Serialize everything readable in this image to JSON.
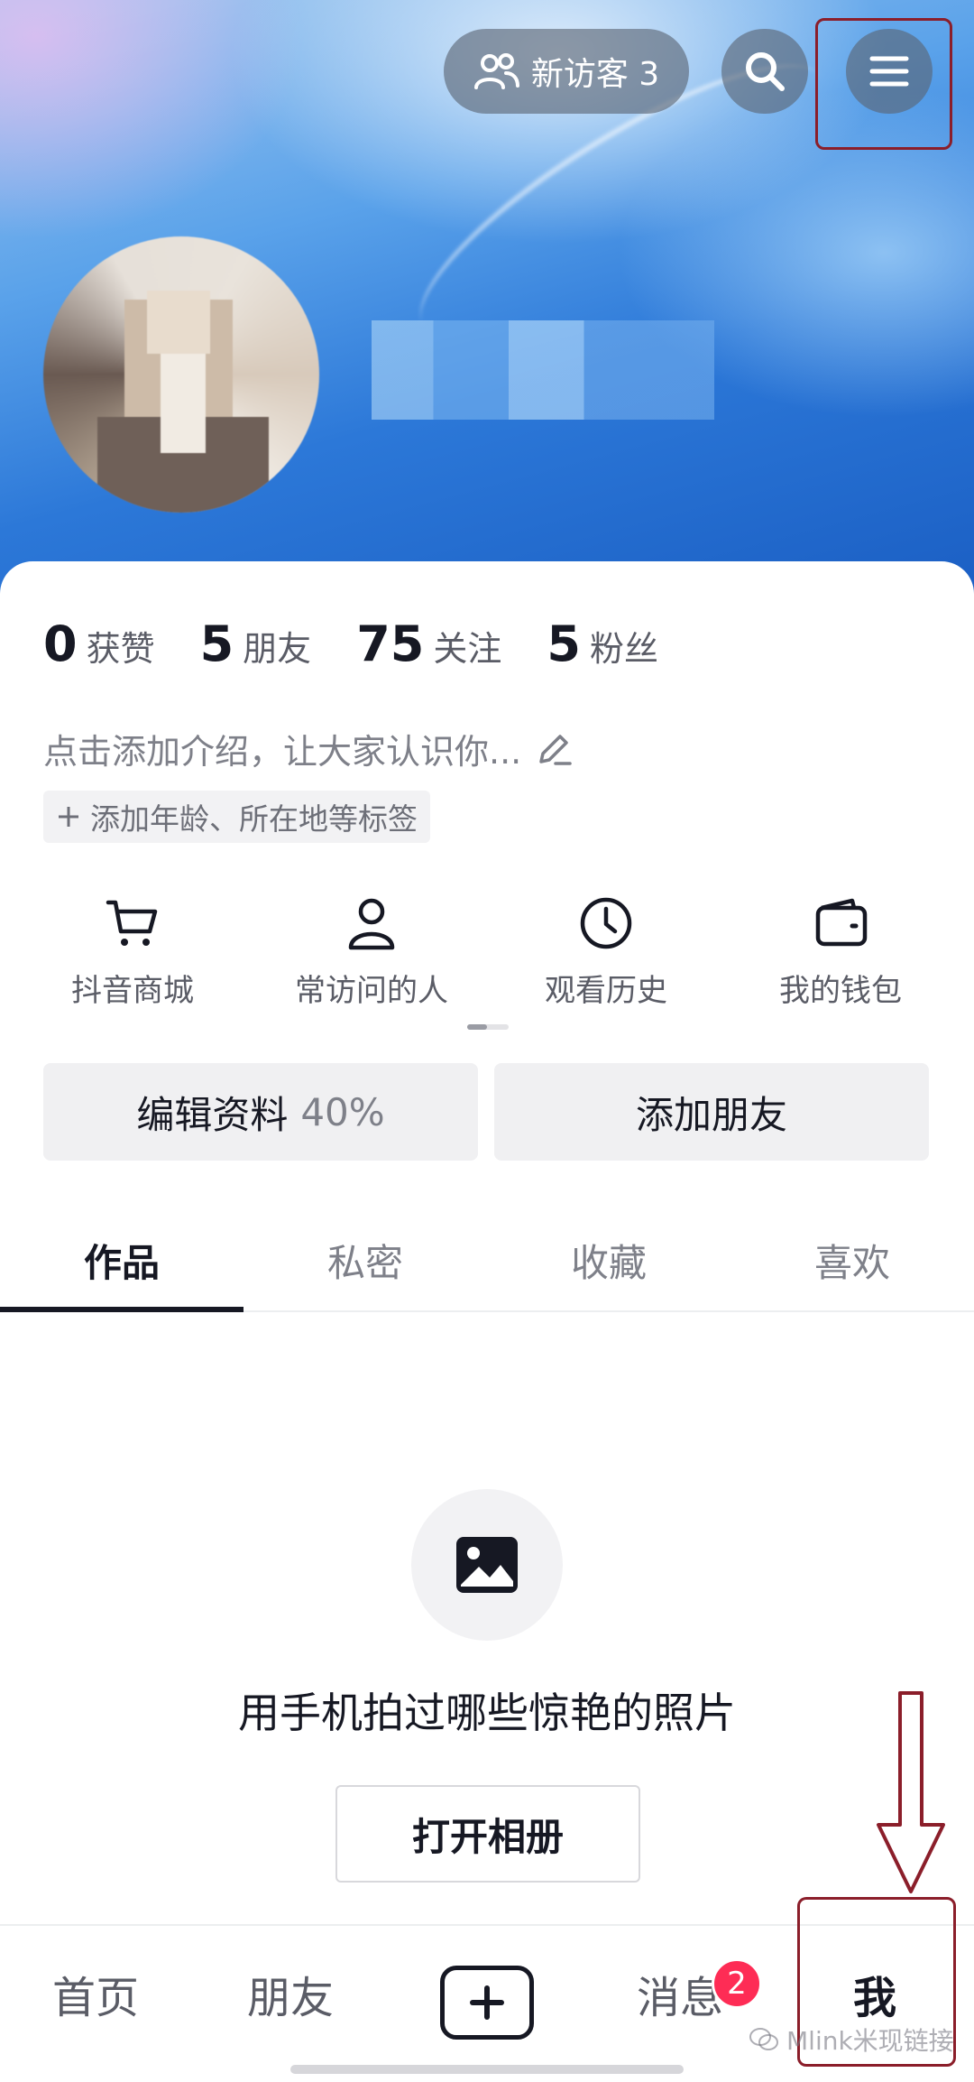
{
  "header": {
    "visitors_label": "新访客 3"
  },
  "stats": [
    {
      "num": "0",
      "label": "获赞"
    },
    {
      "num": "5",
      "label": "朋友"
    },
    {
      "num": "75",
      "label": "关注"
    },
    {
      "num": "5",
      "label": "粉丝"
    }
  ],
  "bio": {
    "placeholder": "点击添加介绍，让大家认识你..."
  },
  "tag_chip": {
    "label": "添加年龄、所在地等标签"
  },
  "shortcuts": [
    {
      "label": "抖音商城",
      "icon": "cart-icon"
    },
    {
      "label": "常访问的人",
      "icon": "person-icon"
    },
    {
      "label": "观看历史",
      "icon": "clock-icon"
    },
    {
      "label": "我的钱包",
      "icon": "wallet-icon"
    }
  ],
  "actions": {
    "edit_label": "编辑资料",
    "edit_progress": "40%",
    "add_friend_label": "添加朋友"
  },
  "tabs": [
    {
      "label": "作品",
      "active": true
    },
    {
      "label": "私密",
      "active": false
    },
    {
      "label": "收藏",
      "active": false
    },
    {
      "label": "喜欢",
      "active": false
    }
  ],
  "empty_state": {
    "icon": "image-icon",
    "message": "用手机拍过哪些惊艳的照片",
    "button_label": "打开相册"
  },
  "bottom_nav": {
    "home": "首页",
    "friends": "朋友",
    "messages": "消息",
    "messages_badge": "2",
    "me": "我"
  },
  "watermark": "Mlink米现链接",
  "colors": {
    "accent_red": "#fe2c55",
    "annotation": "#8b1e2a"
  }
}
